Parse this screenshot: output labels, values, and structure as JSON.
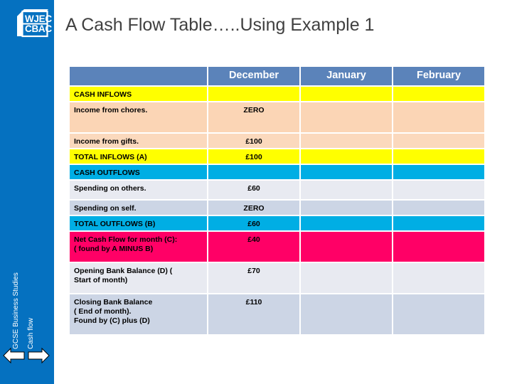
{
  "slide": {
    "title": "A Cash Flow Table…..Using Example 1",
    "logo": {
      "line1": "WJEC",
      "line2": "CBAC"
    },
    "sidebar": {
      "course_label": "GCSE Business Studies",
      "topic_label": "Cash flow",
      "prev_arrow": "previous-slide",
      "next_arrow": "next-slide"
    },
    "colors": {
      "sidebar_blue": "#0571c0",
      "header_blue": "#5b83ba",
      "yellow": "#ffff00",
      "peach": "#fbd5b5",
      "cyan": "#00aee4",
      "gray_light": "#e8eaf1",
      "gray_dark": "#ccd5e5",
      "pink": "#ff0066",
      "title_gray": "#404040"
    }
  },
  "table": {
    "columns": [
      "",
      "December",
      "January",
      "February"
    ],
    "rows": [
      {
        "label": "CASH INFLOWS",
        "december": "",
        "january": "",
        "february": "",
        "style": "bg-yellow",
        "height": "h-20"
      },
      {
        "label": "Income from chores.",
        "december": "ZERO",
        "january": "",
        "february": "",
        "style": "bg-peach",
        "height": "h-42"
      },
      {
        "label": "Income from gifts.",
        "december": "£100",
        "january": "",
        "february": "",
        "style": "bg-peach2",
        "height": "h-20"
      },
      {
        "label": "TOTAL INFLOWS (A)",
        "december": "£100",
        "january": "",
        "february": "",
        "style": "bg-yellow",
        "height": "h-20"
      },
      {
        "label": "CASH OUTFLOWS",
        "december": "",
        "january": "",
        "february": "",
        "style": "bg-cyan",
        "height": "h-20"
      },
      {
        "label": "Spending on others.",
        "december": "£60",
        "january": "",
        "february": "",
        "style": "bg-gray1",
        "height": "h-26"
      },
      {
        "label": "Spending on self.",
        "december": "ZERO",
        "january": "",
        "february": "",
        "style": "bg-gray2",
        "height": "h-20"
      },
      {
        "label": "TOTAL OUTFLOWS (B)",
        "december": "£60",
        "january": "",
        "february": "",
        "style": "bg-cyan",
        "height": "h-20"
      },
      {
        "label": "Net Cash Flow for month (C):\n( found by  A MINUS B)",
        "december": "£40",
        "january": "",
        "february": "",
        "style": "bg-pink",
        "height": "h-42"
      },
      {
        "label": "Opening Bank Balance (D)        (\nStart of month)",
        "december": "£70",
        "january": "",
        "february": "",
        "style": "bg-gray1",
        "height": "h-42"
      },
      {
        "label": "Closing Bank Balance\n( End of month).\nFound by (C) plus (D)",
        "december": "£110",
        "january": "",
        "february": "",
        "style": "bg-gray2",
        "height": "h-56"
      }
    ]
  }
}
